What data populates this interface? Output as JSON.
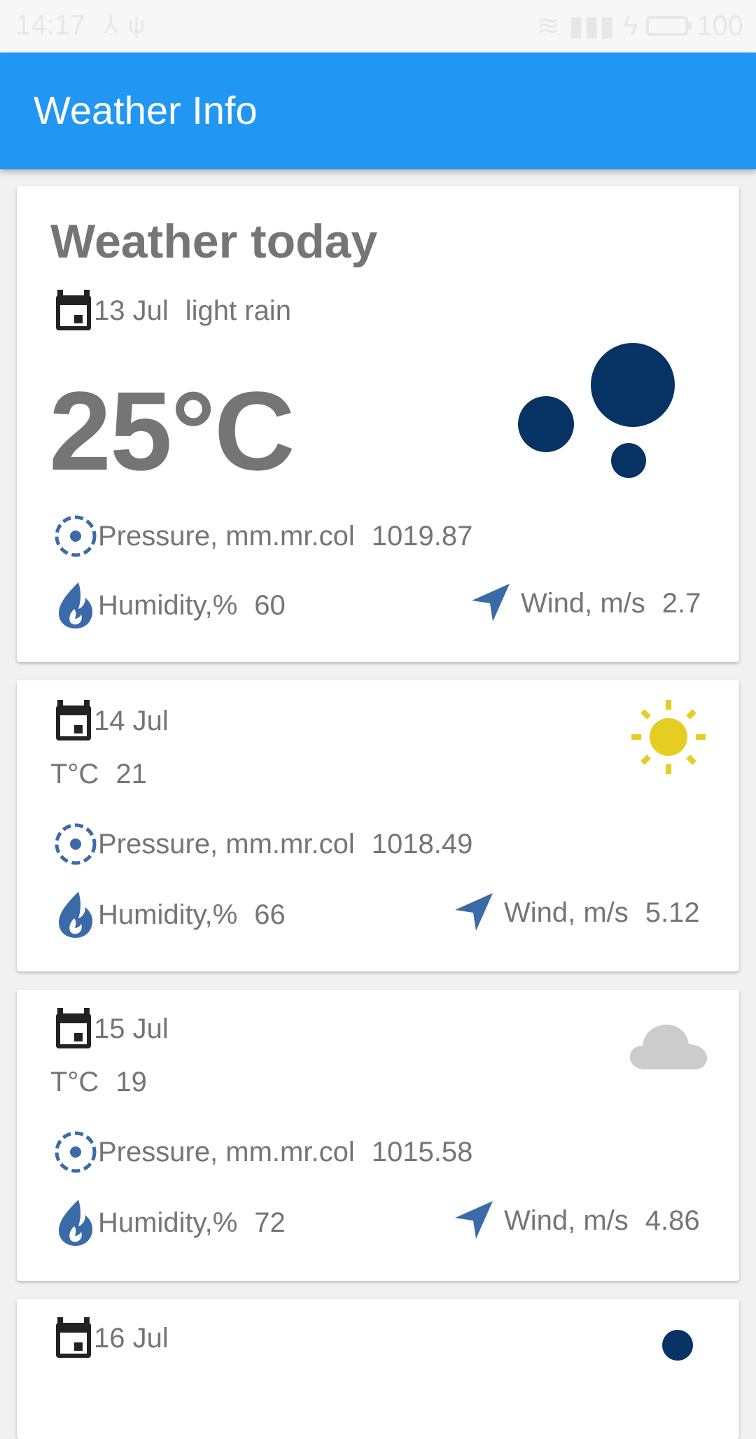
{
  "status_bar": {
    "time": "14:17",
    "battery": "100"
  },
  "app": {
    "title": "Weather Info"
  },
  "today": {
    "heading": "Weather today",
    "date": "13 Jul",
    "description": "light rain",
    "temperature": "25°C",
    "pressure_label": "Pressure, mm.mr.col",
    "pressure_value": "1019.87",
    "humidity_label": "Humidity,%",
    "humidity_value": "60",
    "wind_label": "Wind, m/s",
    "wind_value": "2.7",
    "icon": "rain-drops-icon"
  },
  "forecast": [
    {
      "date": "14 Jul",
      "temp_label": "T°C",
      "temp_value": "21",
      "pressure_label": "Pressure, mm.mr.col",
      "pressure_value": "1018.49",
      "humidity_label": "Humidity,%",
      "humidity_value": "66",
      "wind_label": "Wind, m/s",
      "wind_value": "5.12",
      "icon": "sun-icon"
    },
    {
      "date": "15 Jul",
      "temp_label": "T°C",
      "temp_value": "19",
      "pressure_label": "Pressure, mm.mr.col",
      "pressure_value": "1015.58",
      "humidity_label": "Humidity,%",
      "humidity_value": "72",
      "wind_label": "Wind, m/s",
      "wind_value": "4.86",
      "icon": "cloud-icon"
    },
    {
      "date": "16 Jul",
      "icon": "rain-drops-icon"
    }
  ],
  "colors": {
    "app_bar": "#2196f3",
    "accent_icon": "#3b6aa8",
    "drops": "#063264",
    "sun": "#e5cd22",
    "cloud": "#cccccc",
    "text": "#757575"
  }
}
